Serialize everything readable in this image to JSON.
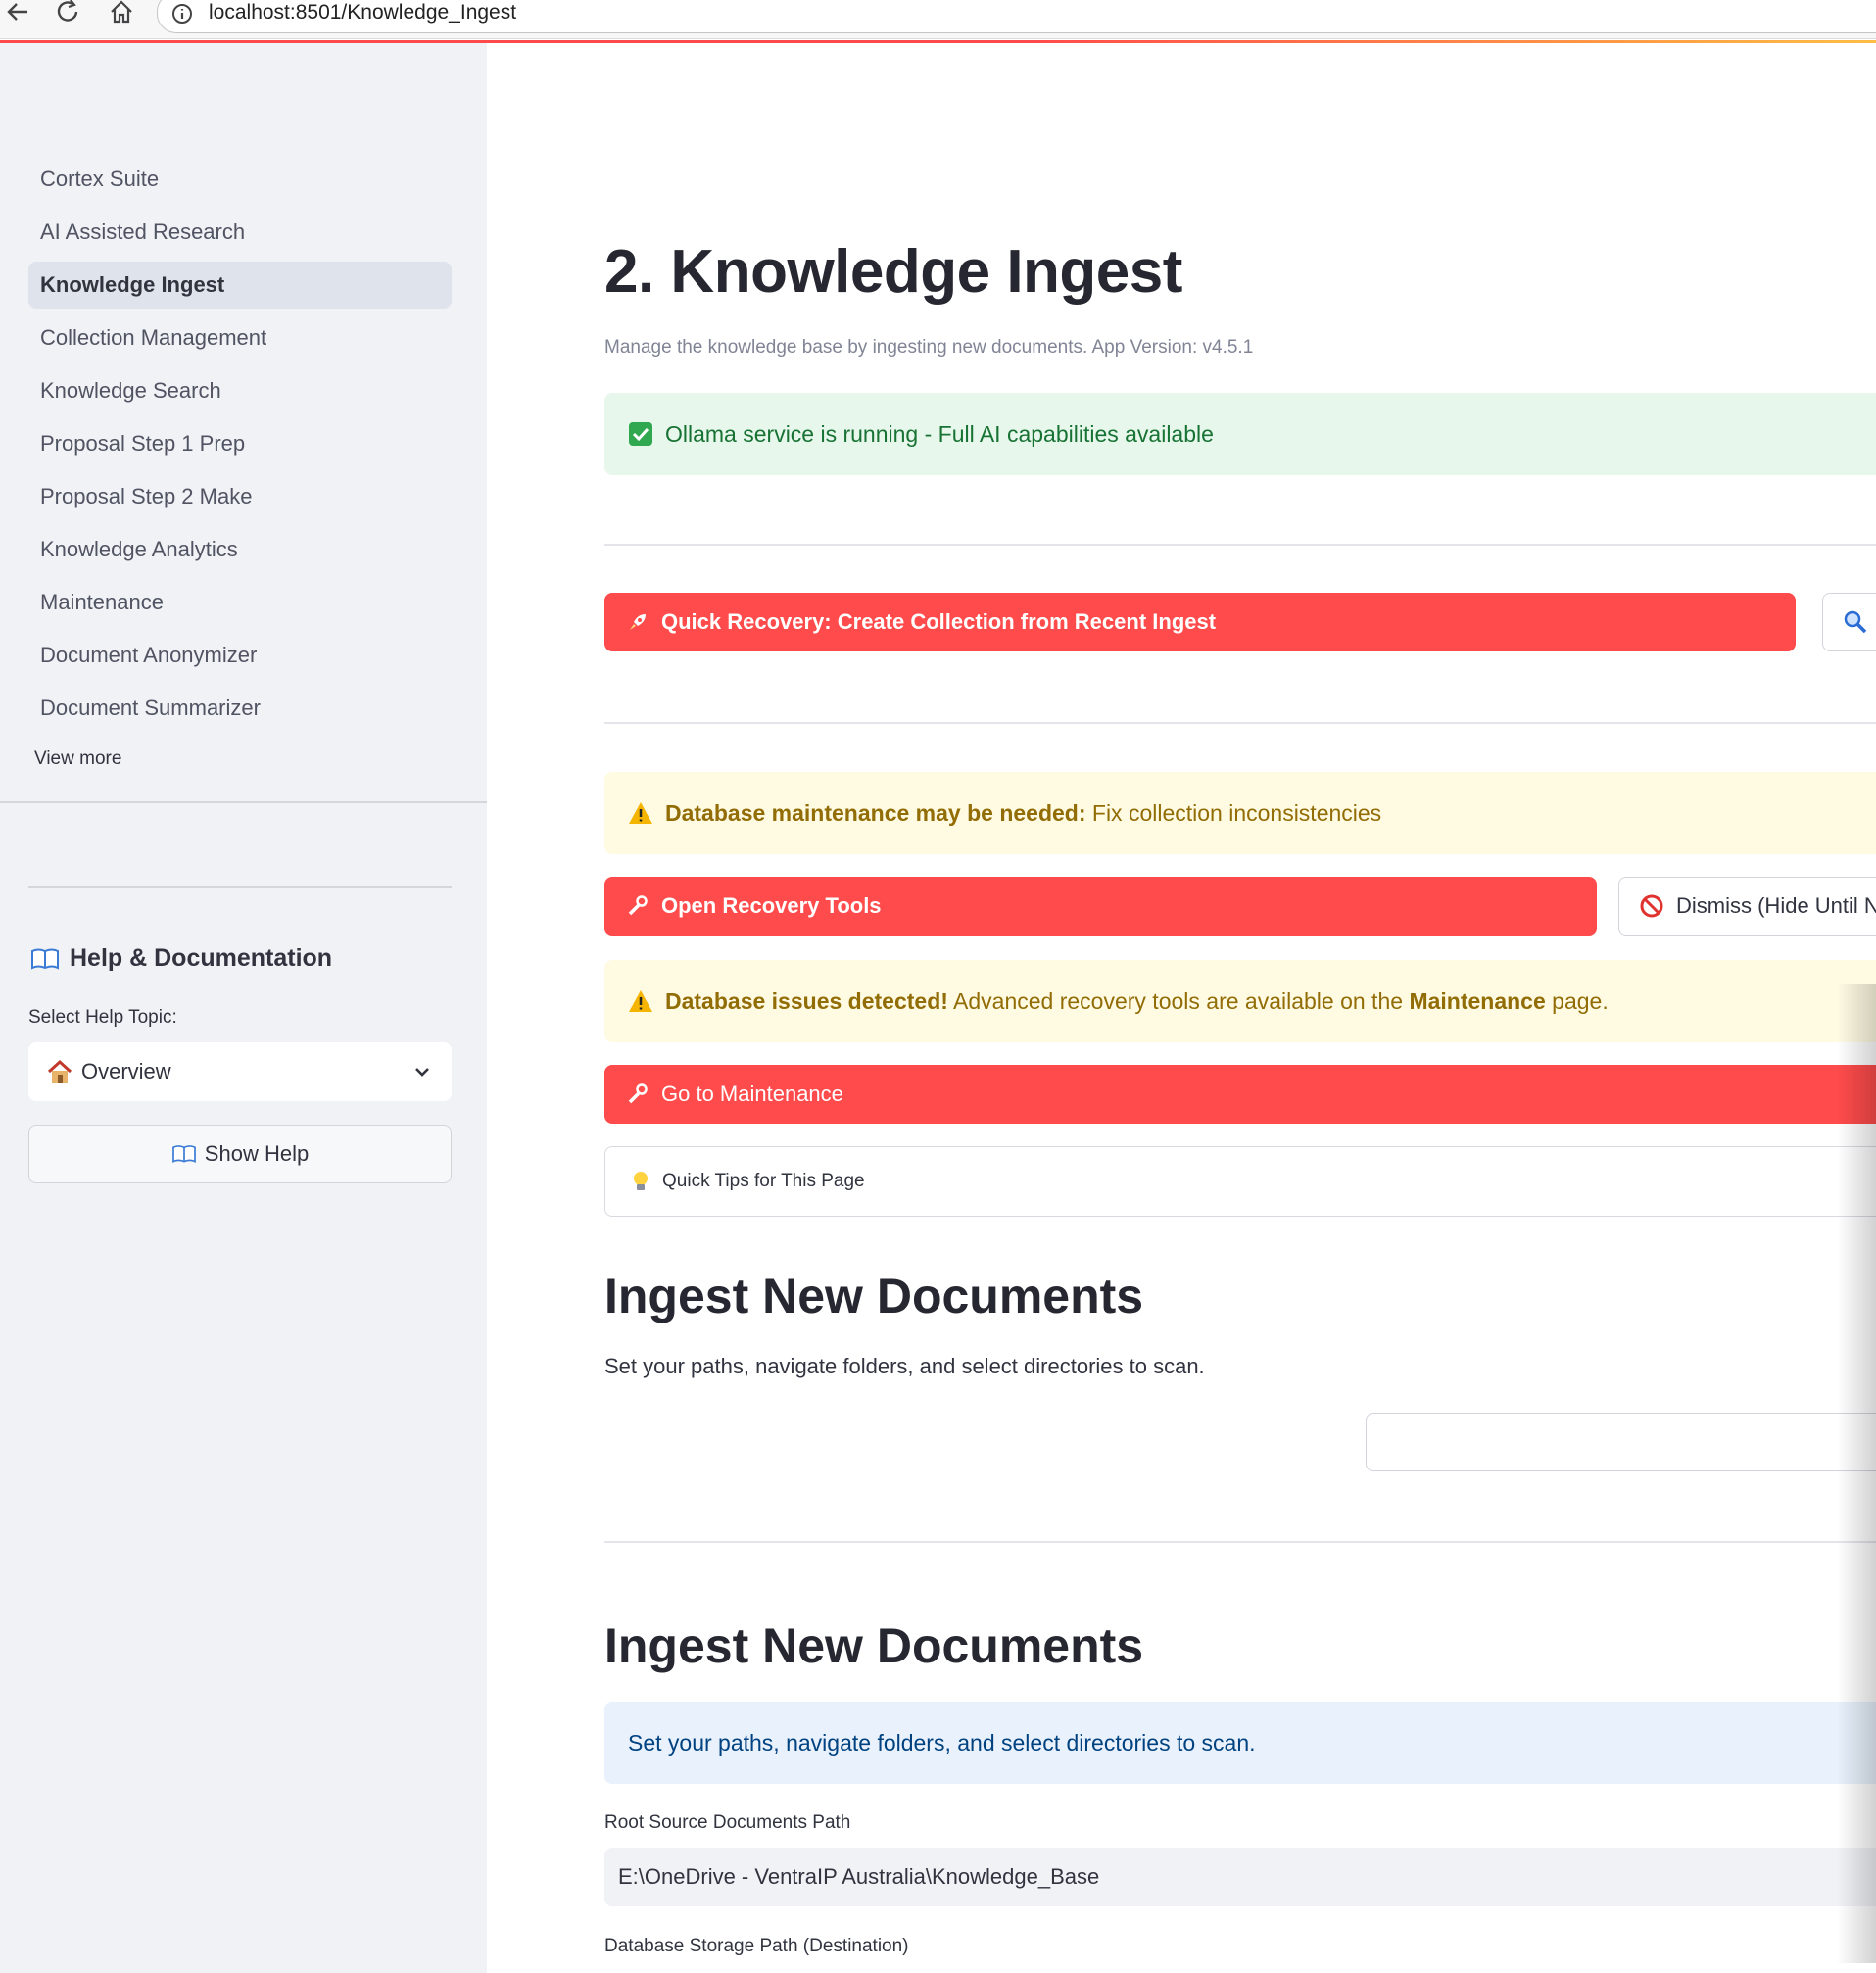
{
  "browser": {
    "url": "localhost:8501/Knowledge_Ingest"
  },
  "sidebar": {
    "nav_items": [
      {
        "label": "Cortex Suite"
      },
      {
        "label": "AI Assisted Research"
      },
      {
        "label": "Knowledge Ingest",
        "active": true
      },
      {
        "label": "Collection Management"
      },
      {
        "label": "Knowledge Search"
      },
      {
        "label": "Proposal Step 1 Prep"
      },
      {
        "label": "Proposal Step 2 Make"
      },
      {
        "label": "Knowledge Analytics"
      },
      {
        "label": "Maintenance"
      },
      {
        "label": "Document Anonymizer"
      },
      {
        "label": "Document Summarizer"
      }
    ],
    "view_more": "View more",
    "help_heading": "Help & Documentation",
    "help_topic_label": "Select Help Topic:",
    "help_topic_value": "Overview",
    "show_help_label": "Show Help"
  },
  "main": {
    "title": "2. Knowledge Ingest",
    "subtitle": "Manage the knowledge base by ingesting new documents. App Version: v4.5.1",
    "ollama_status": "Ollama service is running - Full AI capabilities available",
    "quick_recovery_label": "Quick Recovery: Create Collection from Recent Ingest",
    "db_maintenance_bold": "Database maintenance may be needed:",
    "db_maintenance_text": "Fix collection inconsistencies",
    "open_recovery_label": "Open Recovery Tools",
    "dismiss_label": "Dismiss (Hide Until N",
    "db_issues_bold": "Database issues detected!",
    "db_issues_text_1": "Advanced recovery tools are available on the",
    "db_issues_link": "Maintenance",
    "db_issues_text_2": "page.",
    "go_maintenance_label": "Go to Maintenance",
    "quick_tips_label": "Quick Tips for This Page",
    "ingest_heading_1": "Ingest New Documents",
    "ingest_text_1": "Set your paths, navigate folders, and select directories to scan.",
    "ingest_heading_2": "Ingest New Documents",
    "ingest_info_2": "Set your paths, navigate folders, and select directories to scan.",
    "root_path_label": "Root Source Documents Path",
    "root_path_value": "E:\\OneDrive - VentraIP Australia\\Knowledge_Base",
    "db_path_label": "Database Storage Path (Destination)"
  },
  "colors": {
    "primary_red": "#ff4b4b",
    "sidebar_bg": "#f0f2f6",
    "success_bg": "#e7f7ec",
    "warning_bg": "#fffbe3",
    "info_bg": "#e8f1fc"
  }
}
